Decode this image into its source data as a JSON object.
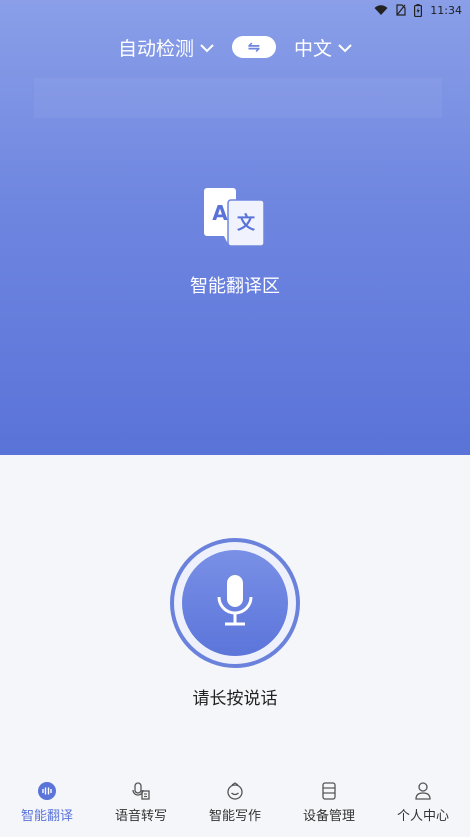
{
  "status": {
    "time": "11:34"
  },
  "lang": {
    "source": "自动检测",
    "target": "中文",
    "swap_glyph": "⇋"
  },
  "zone": {
    "label": "智能翻译区",
    "icon_letters": [
      "A",
      "文"
    ]
  },
  "mic": {
    "label": "请长按说话"
  },
  "nav": {
    "items": [
      {
        "label": "智能翻译",
        "icon": "waveform-icon",
        "active": true
      },
      {
        "label": "语音转写",
        "icon": "transcribe-icon",
        "active": false
      },
      {
        "label": "智能写作",
        "icon": "writing-icon",
        "active": false
      },
      {
        "label": "设备管理",
        "icon": "device-icon",
        "active": false
      },
      {
        "label": "个人中心",
        "icon": "user-icon",
        "active": false
      }
    ]
  },
  "colors": {
    "accent": "#5a74d9",
    "gradient_top": "#8a9fe8",
    "gradient_bottom": "#5a73d8"
  }
}
